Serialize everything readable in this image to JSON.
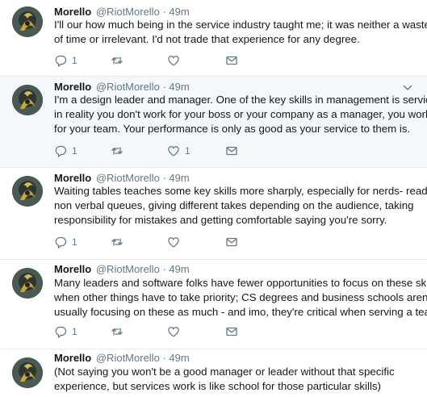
{
  "colors": {
    "text": "#14171a",
    "muted": "#657786",
    "highlight_bg": "#f5f8fa",
    "divider": "#e6ecf0"
  },
  "icons": {
    "reply": "reply-icon",
    "retweet": "retweet-icon",
    "like": "heart-icon",
    "dm": "mail-icon",
    "menu": "chevron-down-icon"
  },
  "tweets": [
    {
      "name": "Morello",
      "handle": "@RiotMorello",
      "dot": "·",
      "time": "49m",
      "lines": [
        "I'll our how much being in the service industry taught me; it was neither a waste",
        "of time or irrelevant. I'd not trade that experience for any degree."
      ],
      "reply_count": "1",
      "retweet_count": "",
      "like_count": "",
      "highlighted": false
    },
    {
      "name": "Morello",
      "handle": "@RiotMorello",
      "dot": "·",
      "time": "49m",
      "lines": [
        "I'm a design leader and manager. One of the key skills in management is service-",
        "in reality you don't work for your boss or your company as a manager, you work",
        "for your team. Your performance is only as good as your service to them is."
      ],
      "reply_count": "1",
      "retweet_count": "",
      "like_count": "1",
      "highlighted": true
    },
    {
      "name": "Morello",
      "handle": "@RiotMorello",
      "dot": "·",
      "time": "49m",
      "lines": [
        "Waiting tables teaches some key skills more sharply, especially for nerds- reading",
        "non verbal queues, giving different takes depending on the audience, taking",
        "responsibility for mistakes and getting comfortable saying you're sorry."
      ],
      "reply_count": "1",
      "retweet_count": "",
      "like_count": "",
      "highlighted": false
    },
    {
      "name": "Morello",
      "handle": "@RiotMorello",
      "dot": "·",
      "time": "49m",
      "lines": [
        "Many leaders and software folks have fewer opportunities to focus on these skills",
        "when other things have to take priority; CS degrees and business schools aren't",
        "usually focusing on these as much - and imo, they're critical when serving a team"
      ],
      "reply_count": "1",
      "retweet_count": "",
      "like_count": "",
      "highlighted": false
    },
    {
      "name": "Morello",
      "handle": "@RiotMorello",
      "dot": "·",
      "time": "49m",
      "lines": [
        "(Not saying you won't be a good manager or leader without that specific",
        "experience, but services work is like school for those particular skills)"
      ],
      "reply_count": "",
      "retweet_count": "",
      "like_count": "",
      "highlighted": false
    }
  ]
}
